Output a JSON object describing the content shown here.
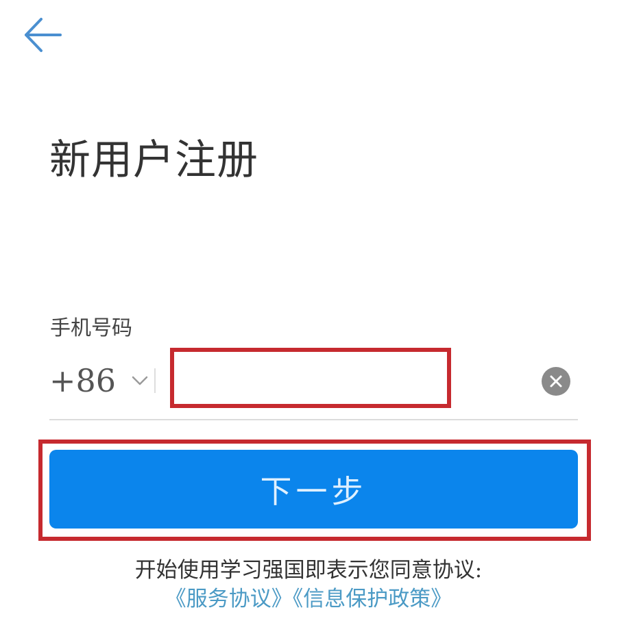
{
  "header": {
    "back_icon": "arrow-left-icon",
    "accent_color": "#4a8fd0"
  },
  "page": {
    "title": "新用户注册"
  },
  "phone": {
    "label": "手机号码",
    "country_code": "+86",
    "country_chevron_icon": "chevron-down-icon",
    "value": "",
    "placeholder": "",
    "clear_icon": "close-circle-icon"
  },
  "actions": {
    "next_label": "下一步",
    "next_color": "#0b85ec"
  },
  "agreement": {
    "text": "开始使用学习强国即表示您同意协议:",
    "service_link": "《服务协议》",
    "privacy_link": "《信息保护政策》",
    "link_color": "#4b9ac5"
  },
  "highlight_color": "#c62a2f"
}
